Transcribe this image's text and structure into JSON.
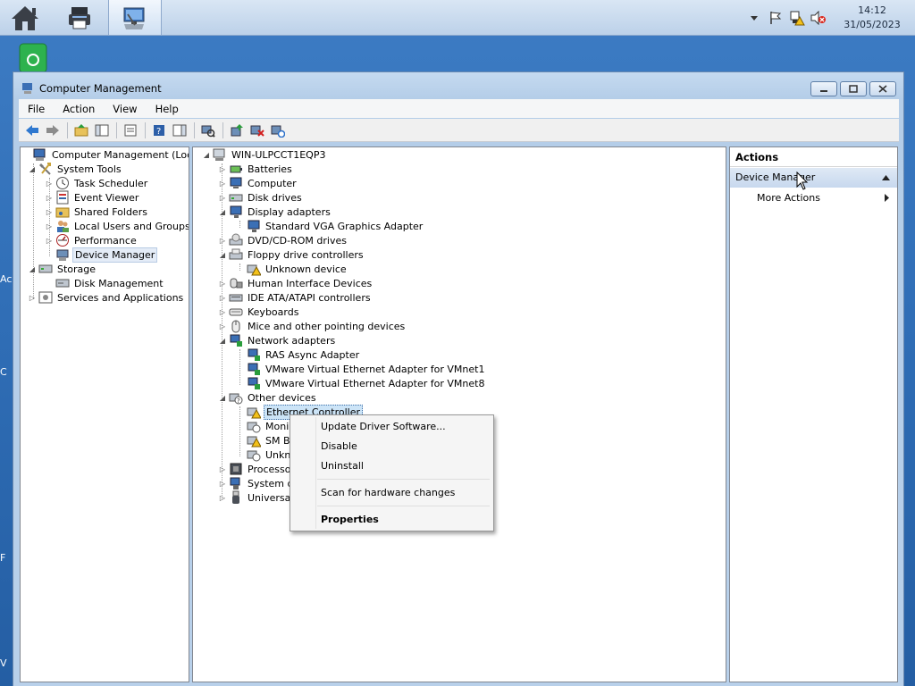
{
  "taskbar": {
    "apps": [
      {
        "icon": "home-icon"
      },
      {
        "icon": "printer-icon"
      },
      {
        "icon": "computer-management-icon",
        "active": true
      }
    ],
    "tray_icons": [
      "show-hidden-icons-chevron",
      "flag-icon",
      "network-warning-icon",
      "volume-muted-icon"
    ],
    "time": "14:12",
    "date": "31/05/2023"
  },
  "desktop": {
    "left_edge_letters": [
      "Ac",
      "C",
      "F",
      "V"
    ]
  },
  "window": {
    "title": "Computer Management",
    "menu": [
      "File",
      "Action",
      "View",
      "Help"
    ]
  },
  "left_tree": {
    "root": "Computer Management (Local)",
    "system_tools": "System Tools",
    "task_scheduler": "Task Scheduler",
    "event_viewer": "Event Viewer",
    "shared_folders": "Shared Folders",
    "local_users": "Local Users and Groups",
    "performance": "Performance",
    "device_manager": "Device Manager",
    "storage": "Storage",
    "disk_management": "Disk Management",
    "services": "Services and Applications"
  },
  "device_tree": {
    "root": "WIN-ULPCCT1EQP3",
    "batteries": "Batteries",
    "computer": "Computer",
    "disk_drives": "Disk drives",
    "display_adapters": "Display adapters",
    "vga": "Standard VGA Graphics Adapter",
    "dvd": "DVD/CD-ROM drives",
    "floppy": "Floppy drive controllers",
    "unknown_device": "Unknown device",
    "hid": "Human Interface Devices",
    "ide": "IDE ATA/ATAPI controllers",
    "keyboards": "Keyboards",
    "mice": "Mice and other pointing devices",
    "network": "Network adapters",
    "ras": "RAS Async Adapter",
    "vmnet1": "VMware Virtual Ethernet Adapter for VMnet1",
    "vmnet8": "VMware Virtual Ethernet Adapter for VMnet8",
    "other": "Other devices",
    "ethernet": "Ethernet Controller",
    "moni_partial": "Moni",
    "smb_partial": "SM B",
    "unkn_partial": "Unkn",
    "processors_partial": "Processo",
    "system_partial": "System d",
    "universal_partial": "Universal"
  },
  "actions": {
    "header": "Actions",
    "device_manager": "Device Manager",
    "more_actions": "More Actions"
  },
  "context_menu": {
    "update": "Update Driver Software...",
    "disable": "Disable",
    "uninstall": "Uninstall",
    "scan": "Scan for hardware changes",
    "properties": "Properties"
  }
}
